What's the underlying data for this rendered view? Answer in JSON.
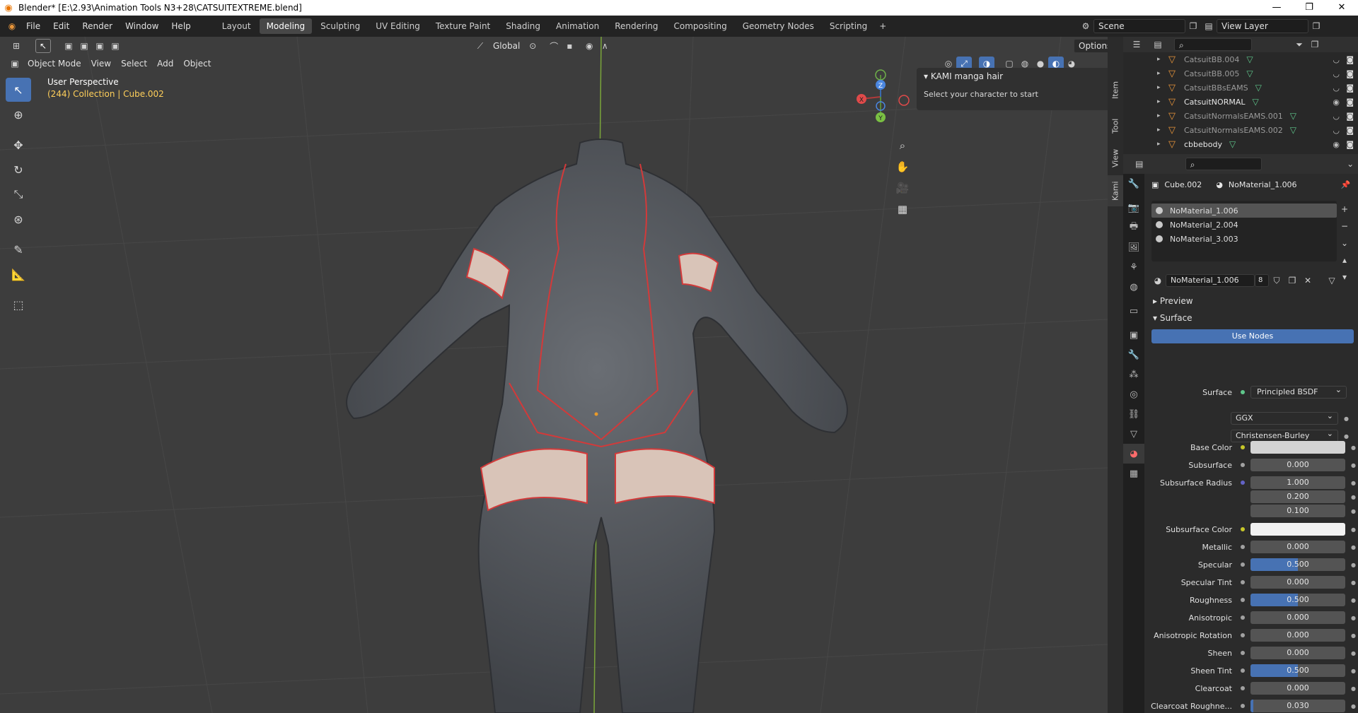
{
  "window": {
    "title": "Blender* [E:\\2.93\\Animation Tools N3+28\\CATSUITEXTREME.blend]"
  },
  "menu": [
    "File",
    "Edit",
    "Render",
    "Window",
    "Help"
  ],
  "workspaces": [
    "Layout",
    "Modeling",
    "Sculpting",
    "UV Editing",
    "Texture Paint",
    "Shading",
    "Animation",
    "Rendering",
    "Compositing",
    "Geometry Nodes",
    "Scripting"
  ],
  "active_workspace": "Modeling",
  "scene": {
    "label": "Scene",
    "view_layer": "View Layer"
  },
  "viewport": {
    "orientation": "Global",
    "options_label": "Options",
    "mode": "Object Mode",
    "header_menus": [
      "View",
      "Select",
      "Add",
      "Object"
    ],
    "perspective": "User Perspective",
    "collection": "(244) Collection | Cube.002"
  },
  "npanel": {
    "title": "KAMI manga hair",
    "text": "Select your character to start",
    "tabs": [
      "Item",
      "Tool",
      "View",
      "Kami"
    ]
  },
  "gizmo": {
    "x": "X",
    "y": "Y",
    "z": "Z"
  },
  "outliner": {
    "rows": [
      {
        "name": "CatsuitBB.004",
        "visible": false
      },
      {
        "name": "CatsuitBB.005",
        "visible": false
      },
      {
        "name": "CatsuitBBsEAMS",
        "visible": false
      },
      {
        "name": "CatsuitNORMAL",
        "visible": true
      },
      {
        "name": "CatsuitNormalsEAMS.001",
        "visible": false
      },
      {
        "name": "CatsuitNormalsEAMS.002",
        "visible": false
      },
      {
        "name": "cbbebody",
        "visible": true
      }
    ]
  },
  "properties": {
    "object": "Cube.002",
    "material": "NoMaterial_1.006",
    "slots": [
      "NoMaterial_1.006",
      "NoMaterial_2.004",
      "NoMaterial_3.003"
    ],
    "material_field": "NoMaterial_1.006",
    "users": "8",
    "preview_label": "Preview",
    "surface_label": "Surface",
    "use_nodes": "Use Nodes",
    "surface_field_label": "Surface",
    "surface_shader": "Principled BSDF",
    "distribution": "GGX",
    "subsurface_method": "Christensen-Burley",
    "params": [
      {
        "label": "Base Color",
        "value": "",
        "type": "color",
        "color": "#d4d4d4"
      },
      {
        "label": "Subsurface",
        "value": "0.000"
      },
      {
        "label": "Subsurface Radius",
        "value": "1.000"
      },
      {
        "label": "",
        "value": "0.200"
      },
      {
        "label": "",
        "value": "0.100"
      },
      {
        "label": "Subsurface Color",
        "value": "",
        "type": "color",
        "color": "#f2f2f2"
      },
      {
        "label": "Metallic",
        "value": "0.000"
      },
      {
        "label": "Specular",
        "value": "0.500",
        "fill": 0.5
      },
      {
        "label": "Specular Tint",
        "value": "0.000"
      },
      {
        "label": "Roughness",
        "value": "0.500",
        "fill": 0.5
      },
      {
        "label": "Anisotropic",
        "value": "0.000"
      },
      {
        "label": "Anisotropic Rotation",
        "value": "0.000"
      },
      {
        "label": "Sheen",
        "value": "0.000"
      },
      {
        "label": "Sheen Tint",
        "value": "0.500",
        "fill": 0.5
      },
      {
        "label": "Clearcoat",
        "value": "0.000"
      },
      {
        "label": "Clearcoat Roughne...",
        "value": "0.030",
        "fill": 0.03
      }
    ]
  },
  "colors": {
    "accent": "#4772b3",
    "object_orange": "#e8953a",
    "mesh_red": "#d23a3a",
    "collection_text": "#ffcf5a"
  }
}
